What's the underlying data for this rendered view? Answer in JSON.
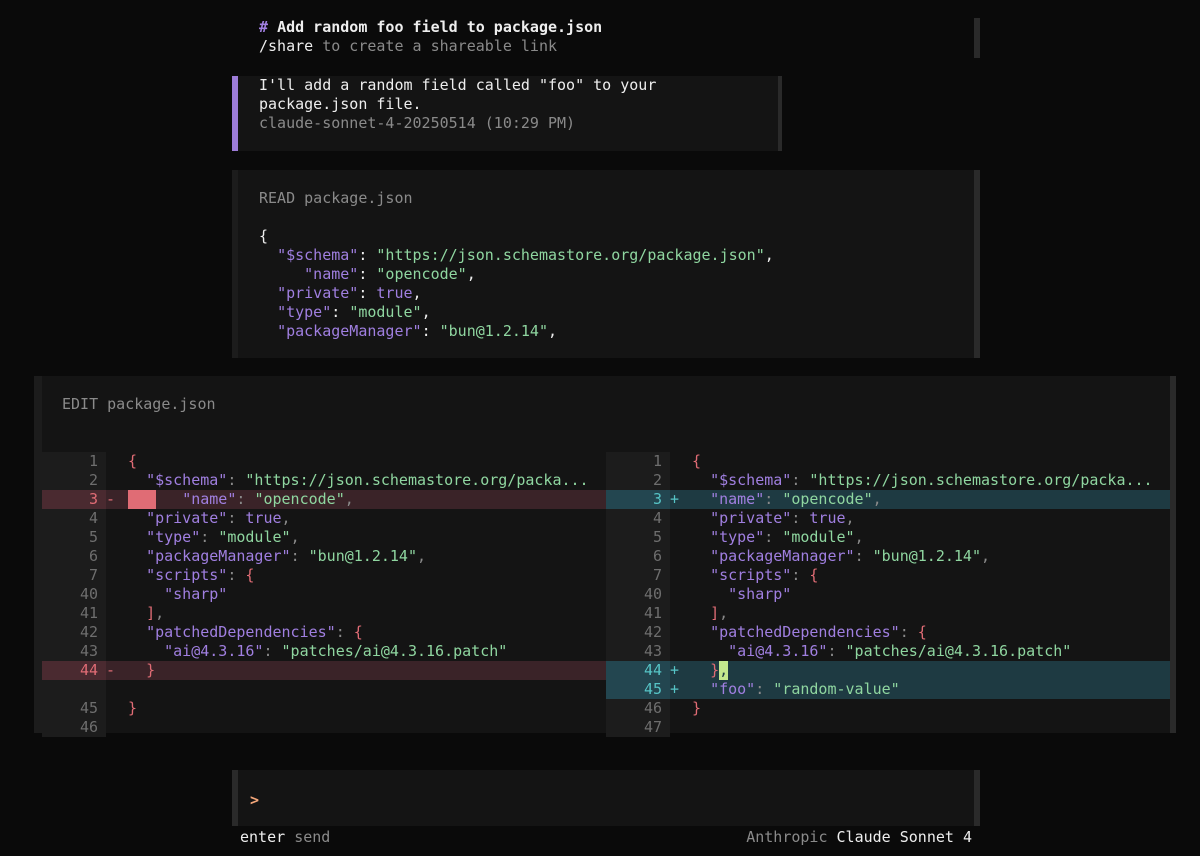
{
  "header": {
    "hash": "#",
    "title": "Add random foo field to package.json",
    "share_cmd": "/share",
    "share_text": "to create a shareable link"
  },
  "message": {
    "line1": "I'll add a random field called \"foo\" to your",
    "line2": "package.json file.",
    "meta": "claude-sonnet-4-20250514 (10:29 PM)"
  },
  "read": {
    "verb": "READ",
    "file": "package.json",
    "code": [
      {
        "indent": "",
        "key": "",
        "val": "",
        "raw": "{"
      },
      {
        "indent": "  ",
        "key": "\"$schema\"",
        "sep": ": ",
        "val": "\"https://json.schemastore.org/package.json\"",
        "tail": ","
      },
      {
        "indent": "     ",
        "key": "\"name\"",
        "sep": ": ",
        "val": "\"opencode\"",
        "tail": ","
      },
      {
        "indent": "  ",
        "key": "\"private\"",
        "sep": ": ",
        "val": "true",
        "tail": ","
      },
      {
        "indent": "  ",
        "key": "\"type\"",
        "sep": ": ",
        "val": "\"module\"",
        "tail": ","
      },
      {
        "indent": "  ",
        "key": "\"packageManager\"",
        "sep": ": ",
        "val": "\"bun@1.2.14\"",
        "tail": ","
      }
    ]
  },
  "edit": {
    "verb": "EDIT",
    "file": "package.json",
    "left": [
      {
        "n": "1",
        "s": "",
        "t": "plain",
        "text": "{"
      },
      {
        "n": "2",
        "s": "",
        "t": "plain",
        "text": "  \"$schema\": \"https://json.schemastore.org/packa..."
      },
      {
        "n": "3",
        "s": "-",
        "t": "del",
        "text": "      \"name\": \"opencode\","
      },
      {
        "n": "4",
        "s": "",
        "t": "plain",
        "text": "  \"private\": true,"
      },
      {
        "n": "5",
        "s": "",
        "t": "plain",
        "text": "  \"type\": \"module\","
      },
      {
        "n": "6",
        "s": "",
        "t": "plain",
        "text": "  \"packageManager\": \"bun@1.2.14\","
      },
      {
        "n": "7",
        "s": "",
        "t": "plain",
        "text": "  \"scripts\": {"
      },
      {
        "n": "40",
        "s": "",
        "t": "plain",
        "text": "    \"sharp\""
      },
      {
        "n": "41",
        "s": "",
        "t": "plain",
        "text": "  ],"
      },
      {
        "n": "42",
        "s": "",
        "t": "plain",
        "text": "  \"patchedDependencies\": {"
      },
      {
        "n": "43",
        "s": "",
        "t": "plain",
        "text": "    \"ai@4.3.16\": \"patches/ai@4.3.16.patch\""
      },
      {
        "n": "44",
        "s": "-",
        "t": "del",
        "text": "  }"
      },
      {
        "n": "",
        "s": "",
        "t": "blank",
        "text": ""
      },
      {
        "n": "45",
        "s": "",
        "t": "plain",
        "text": "}"
      },
      {
        "n": "46",
        "s": "",
        "t": "plain",
        "text": ""
      }
    ],
    "right": [
      {
        "n": "1",
        "s": "",
        "t": "plain",
        "text": "{"
      },
      {
        "n": "2",
        "s": "",
        "t": "plain",
        "text": "  \"$schema\": \"https://json.schemastore.org/packa..."
      },
      {
        "n": "3",
        "s": "+",
        "t": "add",
        "text": "  \"name\": \"opencode\","
      },
      {
        "n": "4",
        "s": "",
        "t": "plain",
        "text": "  \"private\": true,"
      },
      {
        "n": "5",
        "s": "",
        "t": "plain",
        "text": "  \"type\": \"module\","
      },
      {
        "n": "6",
        "s": "",
        "t": "plain",
        "text": "  \"packageManager\": \"bun@1.2.14\","
      },
      {
        "n": "7",
        "s": "",
        "t": "plain",
        "text": "  \"scripts\": {"
      },
      {
        "n": "40",
        "s": "",
        "t": "plain",
        "text": "    \"sharp\""
      },
      {
        "n": "41",
        "s": "",
        "t": "plain",
        "text": "  ],"
      },
      {
        "n": "42",
        "s": "",
        "t": "plain",
        "text": "  \"patchedDependencies\": {"
      },
      {
        "n": "43",
        "s": "",
        "t": "plain",
        "text": "    \"ai@4.3.16\": \"patches/ai@4.3.16.patch\""
      },
      {
        "n": "44",
        "s": "+",
        "t": "add",
        "text": "  },"
      },
      {
        "n": "45",
        "s": "+",
        "t": "add",
        "text": "  \"foo\": \"random-value\""
      },
      {
        "n": "46",
        "s": "",
        "t": "plain",
        "text": "}"
      },
      {
        "n": "47",
        "s": "",
        "t": "plain",
        "text": ""
      }
    ]
  },
  "input": {
    "prompt": ">",
    "value": ""
  },
  "footer": {
    "enter_key": "enter",
    "enter_action": "send",
    "provider": "Anthropic",
    "model": "Claude Sonnet 4"
  },
  "colors": {
    "accent_purple": "#9d7cd8",
    "diff_del_bg": "#3a2328",
    "diff_add_bg": "#1e3a42",
    "string_green": "#8fd6a0",
    "keyword_purple": "#a07fe0",
    "prompt_orange": "#f5a77a"
  }
}
